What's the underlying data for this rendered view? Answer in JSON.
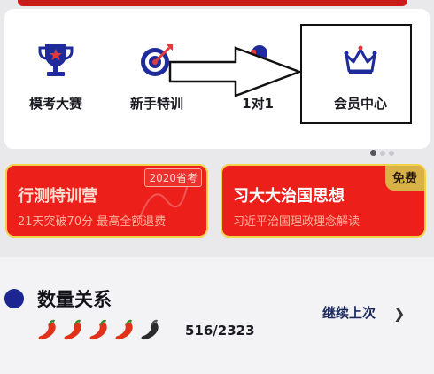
{
  "nav": {
    "items": [
      {
        "label": "模考大赛",
        "icon": "trophy-icon"
      },
      {
        "label": "新手特训",
        "icon": "target-icon"
      },
      {
        "label": "1对1",
        "icon": "tutor-icon"
      },
      {
        "label": "会员中心",
        "icon": "crown-icon"
      }
    ],
    "pager": {
      "count": 3,
      "active": 1
    }
  },
  "promos": {
    "left": {
      "title": "行测特训营",
      "badge": "2020省考",
      "subtitle": "21天突破70分 最高全额退费"
    },
    "right": {
      "title": "习大大治国思想",
      "badge": "免费",
      "subtitle": "习近平治国理政理念解读"
    }
  },
  "section": {
    "title": "数量关系",
    "continue_label": "继续上次",
    "progress": "516/2323",
    "rating": {
      "filled": 4,
      "total": 5
    }
  },
  "colors": {
    "accent_red": "#ec1f1b",
    "navy": "#1c2690",
    "gold": "#d9b247"
  }
}
